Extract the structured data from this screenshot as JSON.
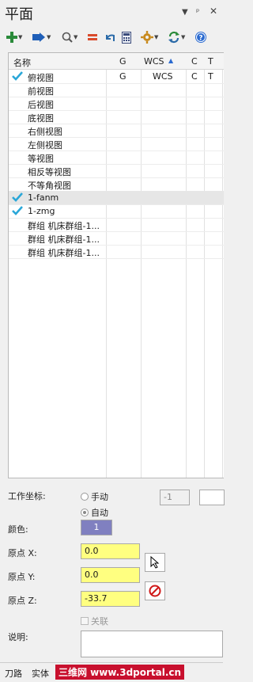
{
  "panel": {
    "title": "平面"
  },
  "table": {
    "headers": {
      "name": "名称",
      "g": "G",
      "wcs": "WCS",
      "c": "C",
      "t": "T"
    },
    "rows": [
      {
        "name": "俯视图",
        "checked": true,
        "g": "G",
        "wcs": "WCS",
        "c": "C",
        "t": "T"
      },
      {
        "name": "前视图",
        "checked": false
      },
      {
        "name": "后视图",
        "checked": false
      },
      {
        "name": "底视图",
        "checked": false
      },
      {
        "name": "右侧视图",
        "checked": false
      },
      {
        "name": "左侧视图",
        "checked": false
      },
      {
        "name": "等视图",
        "checked": false
      },
      {
        "name": "相反等视图",
        "checked": false
      },
      {
        "name": "不等角视图",
        "checked": false
      },
      {
        "name": "1-fanm",
        "checked": true,
        "selected": true
      },
      {
        "name": "1-zmg",
        "checked": true
      },
      {
        "name": "群组 机床群组-1...",
        "checked": false
      },
      {
        "name": "群组 机床群组-1...",
        "checked": false
      },
      {
        "name": "群组 机床群组-1...",
        "checked": false
      }
    ]
  },
  "form": {
    "work_coord_label": "工作坐标:",
    "manual_label": "手动",
    "auto_label": "自动",
    "coord_value": "-1",
    "color_label": "颜色:",
    "color_value": "1",
    "origin_x_label": "原点 X:",
    "origin_x_value": "0.0",
    "origin_y_label": "原点 Y:",
    "origin_y_value": "0.0",
    "origin_z_label": "原点 Z:",
    "origin_z_value": "-33.7",
    "link_label": "关联",
    "desc_label": "说明:"
  },
  "tabs": {
    "toolpath": "刀路",
    "solid": "实体"
  },
  "watermark": "三维网 www.3dportal.cn",
  "colors": {
    "accent": "#2a8a3a",
    "check": "#2aa7d8",
    "field_yellow": "#ffff80",
    "swatch": "#8080c0"
  }
}
